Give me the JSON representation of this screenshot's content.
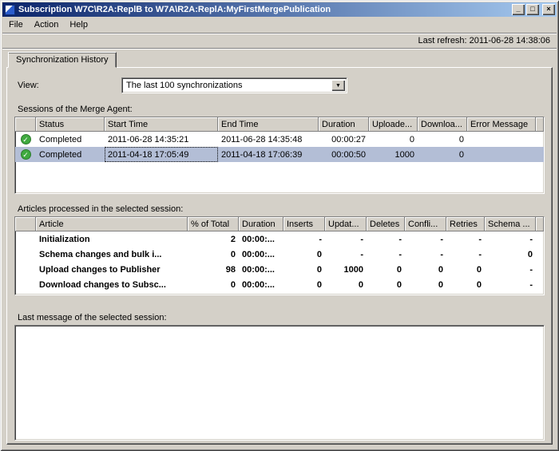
{
  "window": {
    "title": "Subscription W7C\\R2A:ReplB to W7A\\R2A:ReplA:MyFirstMergePublication",
    "menu": [
      "File",
      "Action",
      "Help"
    ],
    "last_refresh": "Last refresh: 2011-06-28 14:38:06"
  },
  "icons": {
    "minimize": "_",
    "maximize": "□",
    "close": "×",
    "dropdown": "▼",
    "status_completed": "✓"
  },
  "tab": {
    "label": "Synchronization History"
  },
  "view": {
    "label": "View:",
    "value": "The last 100 synchronizations"
  },
  "sessions": {
    "label": "Sessions of the Merge Agent:",
    "columns": [
      "",
      "Status",
      "Start Time",
      "End Time",
      "Duration",
      "Uploade...",
      "Downloa...",
      "Error Message"
    ],
    "rows": [
      [
        "Completed",
        "2011-06-28 14:35:21",
        "2011-06-28 14:35:48",
        "00:00:27",
        "0",
        "0",
        ""
      ],
      [
        "Completed",
        "2011-04-18 17:05:49",
        "2011-04-18 17:06:39",
        "00:00:50",
        "1000",
        "0",
        ""
      ]
    ]
  },
  "articles": {
    "label": "Articles processed in the selected session:",
    "columns": [
      "",
      "Article",
      "% of Total",
      "Duration",
      "Inserts",
      "Updat...",
      "Deletes",
      "Confli...",
      "Retries",
      "Schema ..."
    ],
    "rows": [
      [
        "Initialization",
        "2",
        "00:00:...",
        "-",
        "-",
        "-",
        "-",
        "-",
        "-"
      ],
      [
        "Schema changes and bulk i...",
        "0",
        "00:00:...",
        "0",
        "-",
        "-",
        "-",
        "-",
        "0"
      ],
      [
        "Upload changes to Publisher",
        "98",
        "00:00:...",
        "0",
        "1000",
        "0",
        "0",
        "0",
        "-"
      ],
      [
        "Download changes to Subsc...",
        "0",
        "00:00:...",
        "0",
        "0",
        "0",
        "0",
        "0",
        "-"
      ]
    ]
  },
  "last_message": {
    "label": "Last message of the selected session:"
  }
}
